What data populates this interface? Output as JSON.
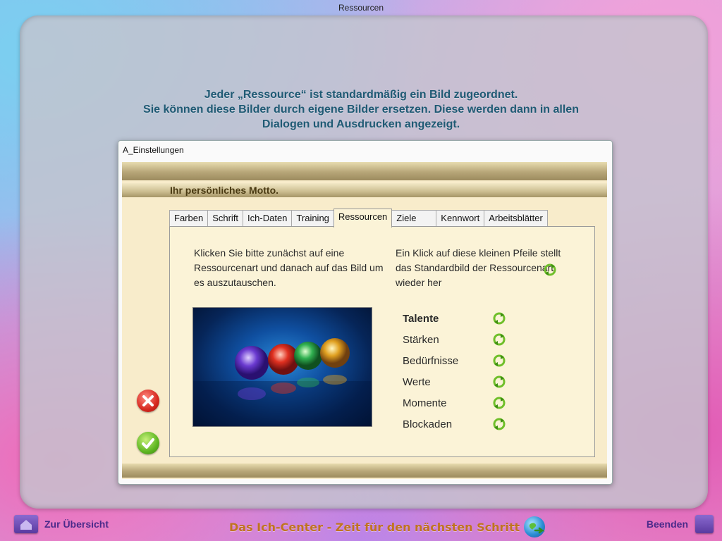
{
  "window": {
    "title": "Ressourcen"
  },
  "headline": {
    "line1": "Jeder „Ressource“ ist standardmäßig ein Bild zugeordnet.",
    "line2": "Sie können diese Bilder durch eigene Bilder ersetzen. Diese werden dann in allen",
    "line3": "Dialogen und Ausdrucken angezeigt."
  },
  "dialog": {
    "title": "A_Einstellungen",
    "motto": "Ihr persönliches Motto.",
    "tabs": [
      {
        "label": "Farben"
      },
      {
        "label": "Schrift"
      },
      {
        "label": "Ich-Daten"
      },
      {
        "label": "Training"
      },
      {
        "label": "Ressourcen",
        "active": true
      },
      {
        "label": "Ziele"
      },
      {
        "label": "Kennwort"
      },
      {
        "label": "Arbeitsblätter"
      }
    ],
    "instruction_left": "Klicken Sie bitte zunächst auf eine Ressourcenart und danach auf das Bild um es auszutauschen.",
    "instruction_right": "Ein Klick auf diese kleinen Pfeile stellt das Standardbild der Ressourcenart wieder her",
    "resources": [
      {
        "label": "Talente",
        "selected": true
      },
      {
        "label": "Stärken"
      },
      {
        "label": "Bedürfnisse"
      },
      {
        "label": "Werte"
      },
      {
        "label": "Momente"
      },
      {
        "label": "Blockaden"
      }
    ],
    "icons": {
      "reset": "refresh-arrows-icon",
      "cancel": "cancel-x-icon",
      "ok": "checkmark-icon",
      "image": "marbles-image"
    }
  },
  "footer": {
    "left_label": "Zur Übersicht",
    "center_label": "Das Ich-Center - Zeit für den nächsten Schritt",
    "right_label": "Beenden",
    "left_icon": "home-icon",
    "right_icon": "exit-icon",
    "center_icon": "globe-icon"
  },
  "colors": {
    "headline": "#1f5a74",
    "panel_bg": "#fbf3d7",
    "brand": "#c07420",
    "footer_text": "#4a2a8a"
  }
}
